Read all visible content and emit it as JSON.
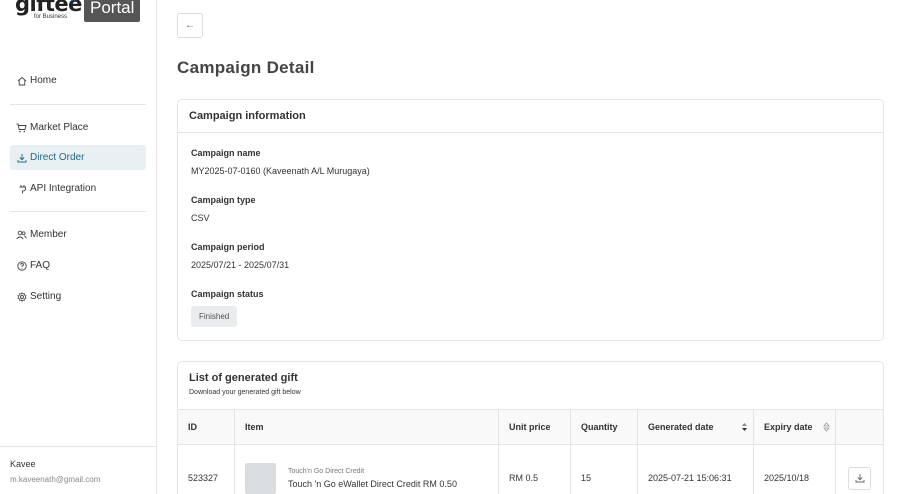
{
  "brand": {
    "logo_word": "giftee",
    "logo_sub": "for Business",
    "portal_label": "Portal"
  },
  "sidebar": {
    "items": [
      {
        "label": "Home",
        "icon": "home-icon"
      },
      {
        "label": "Market Place",
        "icon": "cart-icon"
      },
      {
        "label": "Direct Order",
        "icon": "download-icon",
        "active": true
      },
      {
        "label": "API Integration",
        "icon": "plug-icon"
      },
      {
        "label": "Member",
        "icon": "users-icon"
      },
      {
        "label": "FAQ",
        "icon": "help-icon"
      },
      {
        "label": "Setting",
        "icon": "gear-icon"
      }
    ],
    "user": {
      "name": "Kavee",
      "email": "m.kaveenath@gmail.com"
    }
  },
  "page": {
    "title": "Campaign Detail",
    "back_label": "←"
  },
  "campaign_info": {
    "header": "Campaign information",
    "name_label": "Campaign name",
    "name_value": "MY2025-07-0160 (Kaveenath A/L Murugaya)",
    "type_label": "Campaign type",
    "type_value": "CSV",
    "period_label": "Campaign period",
    "period_value": "2025/07/21 - 2025/07/31",
    "status_label": "Campaign status",
    "status_value": "Finished"
  },
  "gift_list": {
    "title": "List of generated gift",
    "subtitle": "Download your generated gift below",
    "columns": {
      "id": "ID",
      "item": "Item",
      "unit_price": "Unit price",
      "quantity": "Quantity",
      "generated_date": "Generated date",
      "expiry_date": "Expiry date"
    },
    "rows": [
      {
        "id": "523327",
        "brand": "Touch'n Go Direct Credit",
        "item": "Touch 'n Go eWallet Direct Credit RM 0.50",
        "unit_price": "RM 0.5",
        "quantity": "15",
        "generated_date": "2025-07-21 15:06:31",
        "expiry_date": "2025/10/18"
      }
    ]
  },
  "colors": {
    "active_bg": "#e8f0f4",
    "active_text": "#1f6a8a",
    "logo_star": "#2a6fd6"
  }
}
